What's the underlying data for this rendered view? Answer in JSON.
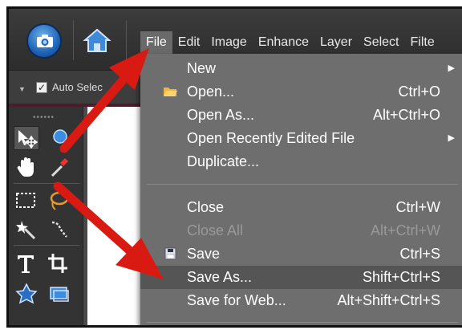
{
  "menubar": {
    "items": [
      "File",
      "Edit",
      "Image",
      "Enhance",
      "Layer",
      "Select",
      "Filte"
    ]
  },
  "options_bar": {
    "auto_select_label": "Auto Selec",
    "auto_select_checked": true
  },
  "file_menu": {
    "groups": [
      [
        {
          "label": "New",
          "shortcut": "",
          "submenu": true,
          "disabled": false,
          "icon": ""
        },
        {
          "label": "Open...",
          "shortcut": "Ctrl+O",
          "submenu": false,
          "disabled": false,
          "icon": "folder-icon"
        },
        {
          "label": "Open As...",
          "shortcut": "Alt+Ctrl+O",
          "submenu": false,
          "disabled": false,
          "icon": ""
        },
        {
          "label": "Open Recently Edited File",
          "shortcut": "",
          "submenu": true,
          "disabled": false,
          "icon": ""
        },
        {
          "label": "Duplicate...",
          "shortcut": "",
          "submenu": false,
          "disabled": false,
          "icon": ""
        }
      ],
      [
        {
          "label": "Close",
          "shortcut": "Ctrl+W",
          "submenu": false,
          "disabled": false,
          "icon": ""
        },
        {
          "label": "Close All",
          "shortcut": "Alt+Ctrl+W",
          "submenu": false,
          "disabled": true,
          "icon": ""
        },
        {
          "label": "Save",
          "shortcut": "Ctrl+S",
          "submenu": false,
          "disabled": false,
          "icon": "floppy-disk-icon"
        },
        {
          "label": "Save As...",
          "shortcut": "Shift+Ctrl+S",
          "submenu": false,
          "disabled": false,
          "icon": "",
          "highlighted": true
        },
        {
          "label": "Save for Web...",
          "shortcut": "Alt+Shift+Ctrl+S",
          "submenu": false,
          "disabled": false,
          "icon": ""
        }
      ]
    ]
  },
  "colors": {
    "annotation_arrow": "#e8241c",
    "menu_bg": "#6e6e6e",
    "menu_highlight": "#555555",
    "organizer_blue": "#1f64b8"
  },
  "icons": [
    "camera-icon",
    "home-icon",
    "move-tool-icon",
    "quick-selection-icon",
    "hand-tool-icon",
    "eyedropper-icon",
    "marquee-icon",
    "lasso-icon",
    "magic-wand-icon",
    "selection-brush-icon",
    "type-tool-icon",
    "crop-tool-icon",
    "cookie-cutter-icon",
    "straighten-icon"
  ]
}
